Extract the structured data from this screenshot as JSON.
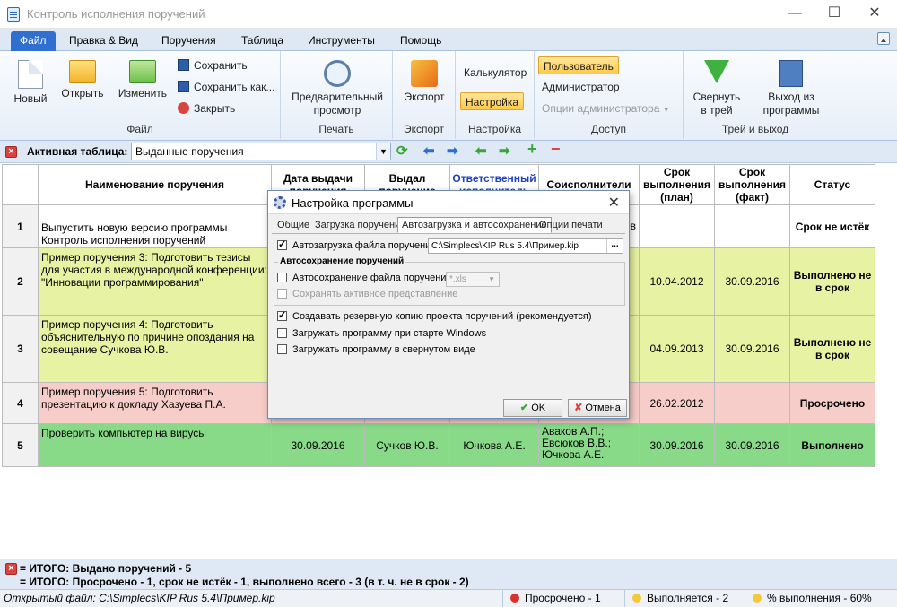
{
  "window": {
    "title": "Контроль исполнения поручений"
  },
  "menu": {
    "tabs": [
      "Файл",
      "Правка & Вид",
      "Поручения",
      "Таблица",
      "Инструменты",
      "Помощь"
    ]
  },
  "ribbon": {
    "file": {
      "new": "Новый",
      "open": "Открыть",
      "edit": "Изменить",
      "save": "Сохранить",
      "save_as": "Сохранить как...",
      "close": "Закрыть",
      "label": "Файл"
    },
    "print": {
      "preview": "Предварительный просмотр",
      "label": "Печать"
    },
    "export": {
      "export": "Экспорт",
      "label": "Экспорт"
    },
    "settings": {
      "calculator": "Калькулятор",
      "settings": "Настройка",
      "label": "Настройка"
    },
    "access": {
      "user": "Пользователь",
      "admin": "Администратор",
      "admin_options": "Опции администратора",
      "label": "Доступ"
    },
    "tray": {
      "minimize": "Свернуть в трей",
      "exit": "Выход из программы",
      "label": "Трей и выход"
    }
  },
  "toolbar": {
    "label": "Активная таблица:",
    "value": "Выданные поручения"
  },
  "table": {
    "headers": [
      "Наименование поручения",
      "Дата выдачи поручения",
      "Выдал поручение",
      "Ответственный исполнитель",
      "Соисполнители",
      "Срок выполнения (план)",
      "Срок выполнения (факт)",
      "Статус"
    ],
    "rows": [
      {
        "num": "1",
        "name": "Выпустить новую версию программы Контроль исполнения поручений",
        "issued": "",
        "by": "",
        "resp": "",
        "co": "ев",
        "plan": "",
        "fact": "",
        "status": "Срок не истёк"
      },
      {
        "num": "2",
        "name": "Пример поручения 3: Подготовить тезисы для участия в международной конференции: \"Инновации программирования\"",
        "issued": "",
        "by": "",
        "resp": "",
        "co": "",
        "plan": "10.04.2012",
        "fact": "30.09.2016",
        "status": "Выполнено не в срок"
      },
      {
        "num": "3",
        "name": "Пример поручения 4: Подготовить объяснительную по причине опоздания на совещание Сучкова Ю.В.",
        "issued": "",
        "by": "",
        "resp": "",
        "co": "",
        "plan": "04.09.2013",
        "fact": "30.09.2016",
        "status": "Выполнено не в срок"
      },
      {
        "num": "4",
        "name": "Пример поручения 5: Подготовить презентацию к докладу Хазуева П.А.",
        "issued": "",
        "by": "",
        "resp": "",
        "co": "",
        "plan": "26.02.2012",
        "fact": "",
        "status": "Просрочено"
      },
      {
        "num": "5",
        "name": "Проверить компьютер на вирусы",
        "issued": "30.09.2016",
        "by": "Сучков Ю.В.",
        "resp": "Ючкова А.Е.",
        "co": "Аваков А.П.; Евсюков В.В.; Ючкова А.Е.",
        "plan": "30.09.2016",
        "fact": "30.09.2016",
        "status": "Выполнено"
      }
    ]
  },
  "summary": {
    "line1": "= ИТОГО: Выдано поручений - 5",
    "line2": "= ИТОГО: Просрочено - 1, срок не истёк - 1, выполнено всего - 3 (в т. ч. не в срок - 2)"
  },
  "statusbar": {
    "file": "Открытый файл: C:\\Simplecs\\KIP Rus 5.4\\Пример.kip",
    "overdue": "Просрочено - 1",
    "in_progress": "Выполняется - 2",
    "percent": "% выполнения - 60%"
  },
  "dialog": {
    "title": "Настройка программы",
    "tabs": [
      "Общие",
      "Загрузка поручений",
      "Автозагрузка и автосохранение",
      "Опции печати"
    ],
    "autoload_label": "Автозагрузка файла поручений",
    "autoload_path": "C:\\Simplecs\\KIP Rus 5.4\\Пример.kip",
    "path_button": "...",
    "autosave_group": "Автосохранение поручений",
    "autosave_label": "Автосохранение файла поручений",
    "autosave_format": "*.xls",
    "save_active_view": "Сохранять активное представление",
    "backup": "Создавать резервную копию проекта поручений (рекомендуется)",
    "load_on_start": "Загружать программу при старте Windows",
    "load_minimized": "Загружать программу в свернутом виде",
    "ok": "OK",
    "cancel": "Отмена"
  },
  "colors": {
    "accent": "#2f6fd0",
    "yellow_row": "#e8f2a3",
    "red_row": "#f7cdc9",
    "green_row": "#88da88"
  }
}
